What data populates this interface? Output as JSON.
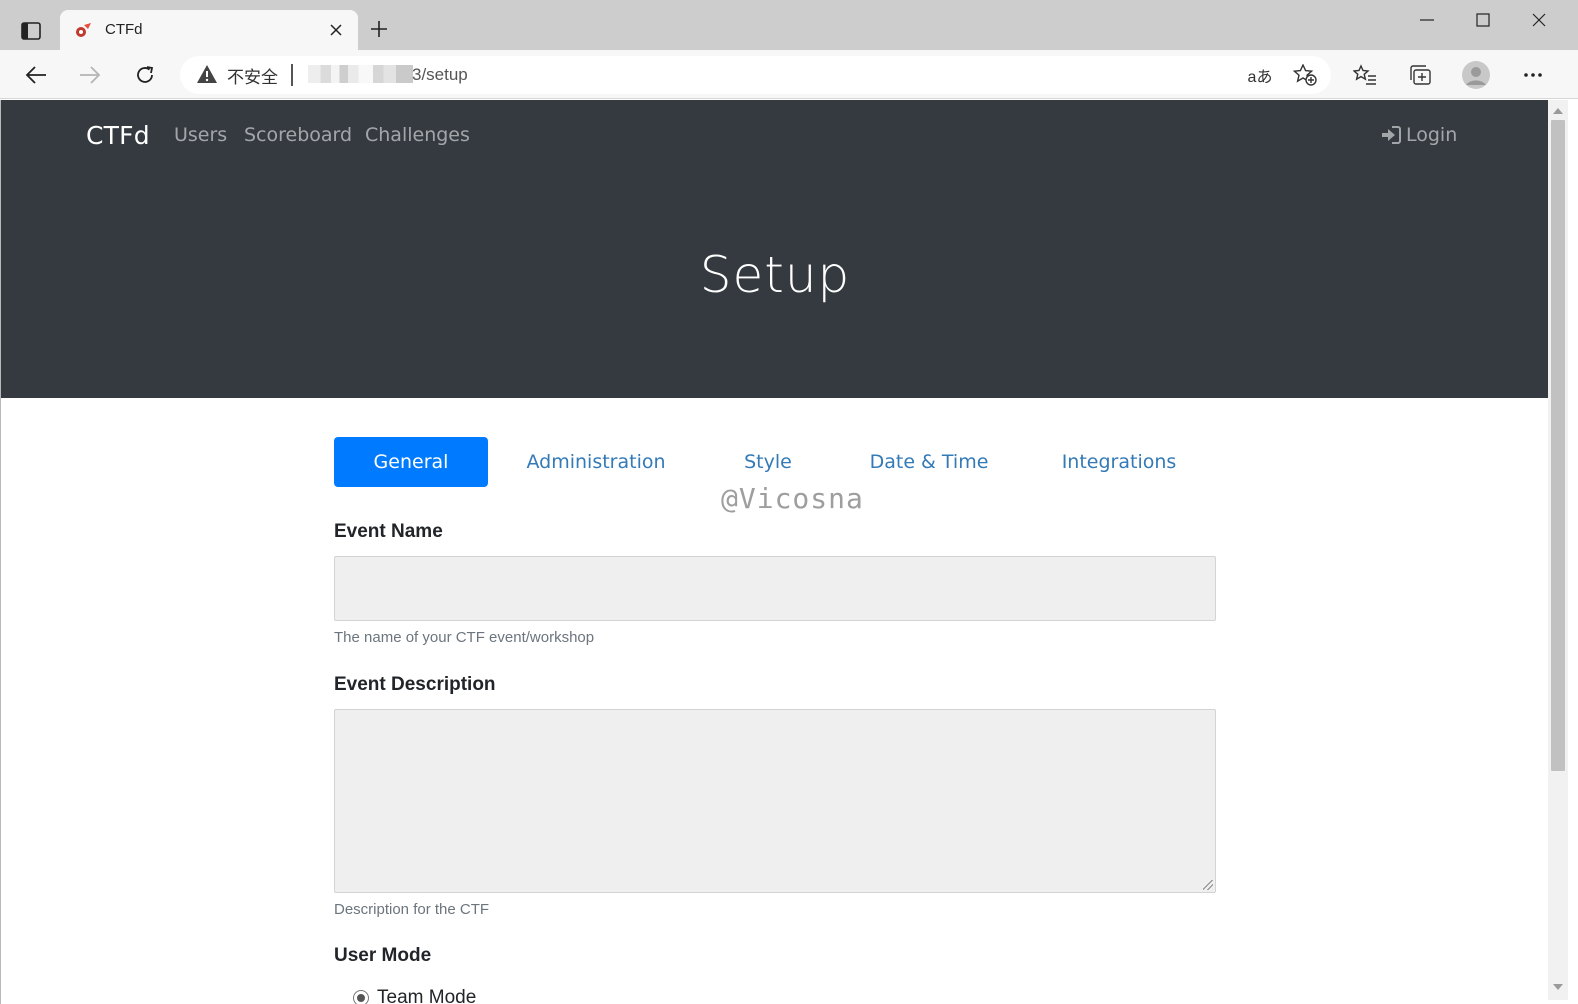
{
  "browser": {
    "tab_title": "CTFd",
    "address_security_label": "不安全",
    "address_url_visible": "3/setup",
    "translate_glyph": "aあ"
  },
  "nav": {
    "brand": "CTFd",
    "links": [
      "Users",
      "Scoreboard",
      "Challenges"
    ],
    "login": "Login"
  },
  "hero": {
    "title": "Setup"
  },
  "setup_tabs": {
    "items": [
      "General",
      "Administration",
      "Style",
      "Date & Time",
      "Integrations"
    ],
    "active": "General"
  },
  "watermark": "@Vicosna",
  "form": {
    "event_name": {
      "label": "Event Name",
      "value": "",
      "help": "The name of your CTF event/workshop"
    },
    "event_description": {
      "label": "Event Description",
      "value": "",
      "help": "Description for the CTF"
    },
    "user_mode": {
      "label": "User Mode",
      "option_visible": "Team Mode"
    }
  },
  "colors": {
    "navbar_bg": "#343a40",
    "active_tab_bg": "#007bff",
    "tab_link": "#337ab7",
    "input_bg": "#efefef"
  },
  "icons": {
    "tab_actions": "tab-actions-icon",
    "favicon": "ctfd-favicon",
    "close": "close-icon",
    "new_tab": "plus-icon",
    "back": "back-arrow-icon",
    "forward": "forward-arrow-icon",
    "reload": "reload-icon",
    "warning": "warning-icon",
    "translate": "translate-icon",
    "add_favorite": "star-plus-icon",
    "favorites": "favorites-icon",
    "collections": "collections-icon",
    "profile": "profile-icon",
    "more": "more-icon",
    "login": "sign-in-icon"
  }
}
